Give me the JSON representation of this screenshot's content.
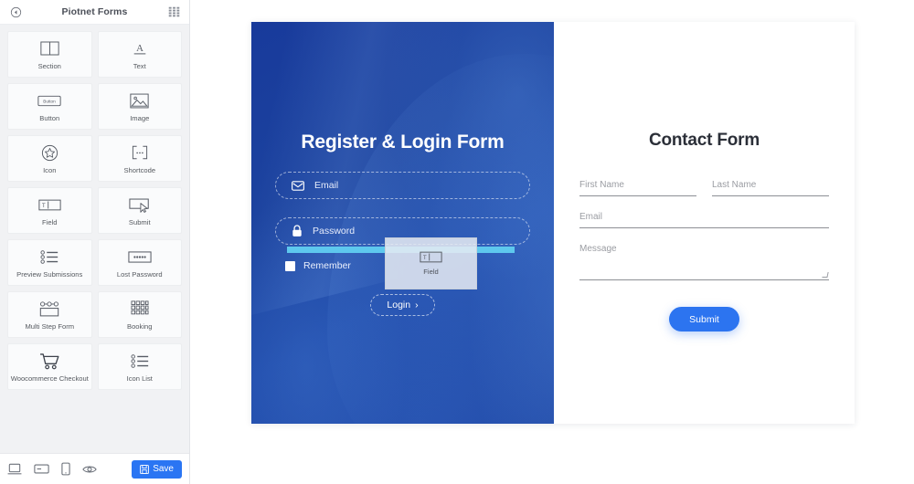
{
  "panel": {
    "title": "Piotnet Forms",
    "back_icon": "back-arrow-circle-icon",
    "grid_icon": "apps-grid-icon",
    "widgets": [
      {
        "label": "Section",
        "icon": "section-columns-icon"
      },
      {
        "label": "Text",
        "icon": "text-letter-a-icon"
      },
      {
        "label": "Button",
        "icon": "button-icon",
        "inner_text": "Button"
      },
      {
        "label": "Image",
        "icon": "image-mountain-icon"
      },
      {
        "label": "Icon",
        "icon": "star-badge-icon"
      },
      {
        "label": "Shortcode",
        "icon": "shortcode-brackets-icon",
        "inner_text": "..."
      },
      {
        "label": "Field",
        "icon": "field-text-input-icon",
        "inner_text": "T"
      },
      {
        "label": "Submit",
        "icon": "submit-cursor-icon"
      },
      {
        "label": "Preview Submissions",
        "icon": "list-bullets-icon"
      },
      {
        "label": "Lost Password",
        "icon": "password-dots-icon"
      },
      {
        "label": "Multi Step Form",
        "icon": "multi-step-icon"
      },
      {
        "label": "Booking",
        "icon": "booking-calendar-grid-icon"
      },
      {
        "label": "Woocommerce Checkout",
        "icon": "shopping-cart-icon"
      },
      {
        "label": "Icon List",
        "icon": "icon-list-icon"
      }
    ],
    "footer": {
      "devices": [
        {
          "name": "desktop-view-icon"
        },
        {
          "name": "tablet-view-icon"
        },
        {
          "name": "mobile-view-icon"
        },
        {
          "name": "preview-eye-icon"
        }
      ],
      "save_label": "Save",
      "save_icon": "save-disk-icon",
      "save_color": "#2a75f3"
    }
  },
  "canvas": {
    "login_panel": {
      "title": "Register & Login Form",
      "background_color": "#1c439f",
      "fields": [
        {
          "label": "Email",
          "icon": "envelope-icon"
        },
        {
          "label": "Password",
          "icon": "lock-icon"
        }
      ],
      "remember_label": "Remember",
      "remember_checked": false,
      "login_label": "Login",
      "login_chevron": "›",
      "drop_indicator_color": "#5ec8ee"
    },
    "drag_ghost": {
      "label": "Field",
      "icon": "field-text-input-icon",
      "inner_text": "T"
    },
    "contact_panel": {
      "title": "Contact Form",
      "fields": [
        {
          "name": "first-name",
          "placeholder": "First Name"
        },
        {
          "name": "last-name",
          "placeholder": "Last Name"
        },
        {
          "name": "email",
          "placeholder": "Email"
        },
        {
          "name": "message",
          "placeholder": "Message"
        }
      ],
      "submit_label": "Submit",
      "submit_color": "#2c74f0"
    }
  }
}
